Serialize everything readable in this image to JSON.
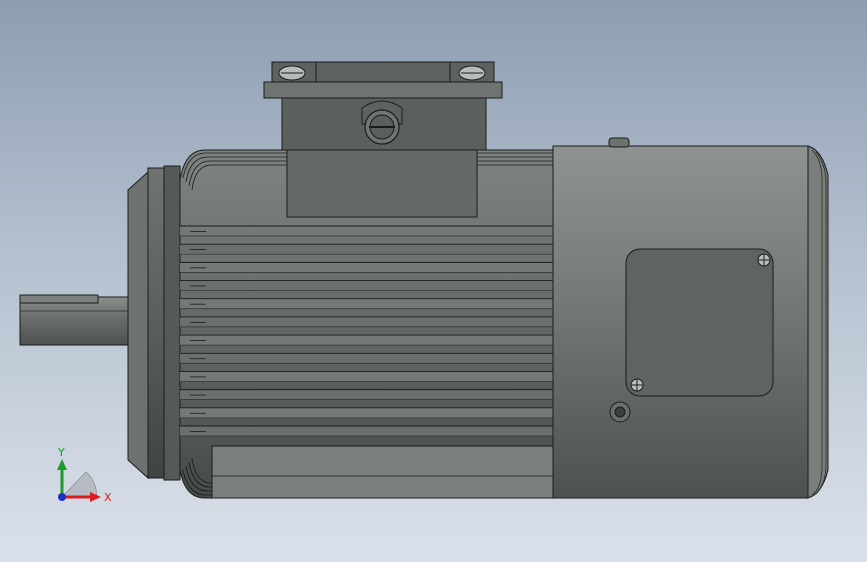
{
  "viewport": {
    "background_top": "#8d9db2",
    "background_bottom": "#dbe1ea"
  },
  "model": {
    "body_color": "#5e6360",
    "body_light": "#7d827f",
    "body_dark": "#3e4240",
    "edge_color": "#1a1c1b",
    "fin_count": 10
  },
  "triad": {
    "x_label": "X",
    "y_label": "Y",
    "x_color": "#d81e1e",
    "y_color": "#1e9a2a",
    "z_color": "#1d2fc4"
  }
}
